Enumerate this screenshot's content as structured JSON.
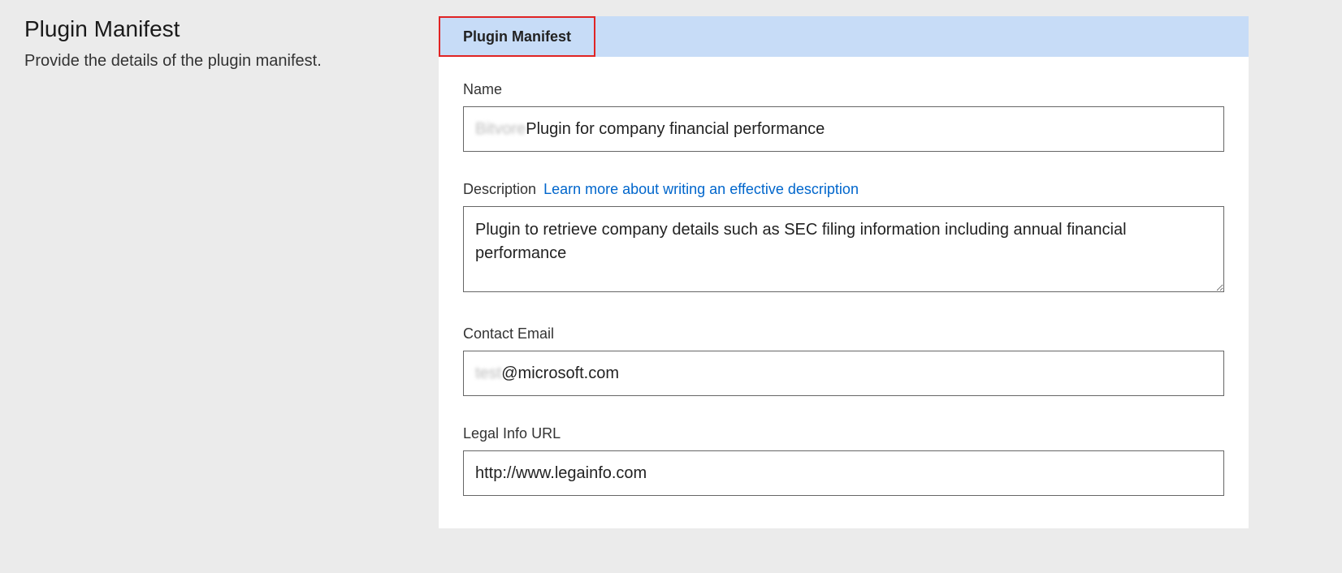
{
  "sidebar": {
    "title": "Plugin Manifest",
    "description": "Provide the details of the plugin manifest."
  },
  "tabs": {
    "active": "Plugin Manifest"
  },
  "form": {
    "name": {
      "label": "Name",
      "prefix_blurred": "Bitvore",
      "value": " Plugin for company financial performance"
    },
    "description": {
      "label": "Description",
      "link_text": "Learn more about writing an effective description",
      "value": "Plugin to retrieve company details such as SEC filing information including annual financial performance"
    },
    "contact_email": {
      "label": "Contact Email",
      "prefix_blurred": "test",
      "value": "@microsoft.com"
    },
    "legal_url": {
      "label": "Legal Info URL",
      "value": "http://www.legainfo.com"
    }
  }
}
